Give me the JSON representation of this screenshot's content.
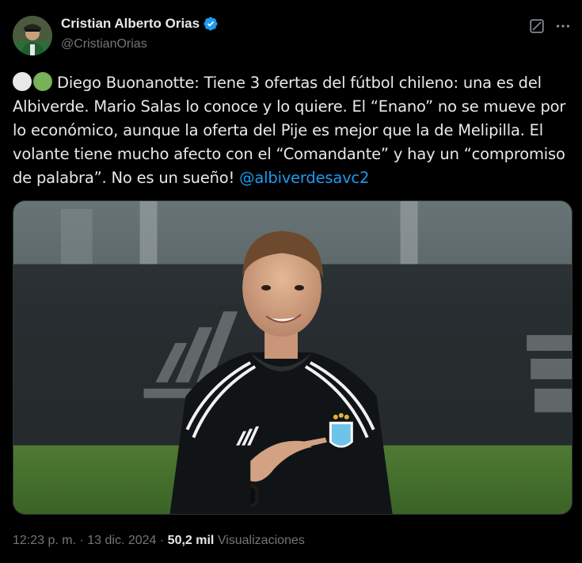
{
  "author": {
    "name": "Cristian Alberto Orias",
    "handle": "@CristianOrias",
    "verified": true,
    "verified_color": "#1d9bf0"
  },
  "icons": {
    "grok": "grok-slash-icon",
    "more": "more-dots-icon",
    "verified": "verified-badge-icon"
  },
  "tweet": {
    "emoji_1": "white-circle",
    "emoji_2": "green-circle",
    "body_text": "Diego Buonanotte: Tiene 3 ofertas del fútbol chileno: una es del Albiverde. Mario Salas lo conoce y lo quiere. El “Enano” no se mueve por lo económico, aunque la oferta del Pije es mejor que la de Melipilla. El volante tiene mucho afecto con el “Comandante” y hay un “compromiso de palabra”. No es un sueño!",
    "mention": "@albiverdesavc2"
  },
  "meta": {
    "time": "12:23 p. m.",
    "separator_1": " · ",
    "date": "13 dic. 2024",
    "separator_2": " · ",
    "views_count": "50,2 mil",
    "views_label": " Visualizaciones"
  },
  "colors": {
    "background": "#000000",
    "text_primary": "#e7e9ea",
    "text_secondary": "#71767b",
    "link": "#1d9bf0"
  }
}
